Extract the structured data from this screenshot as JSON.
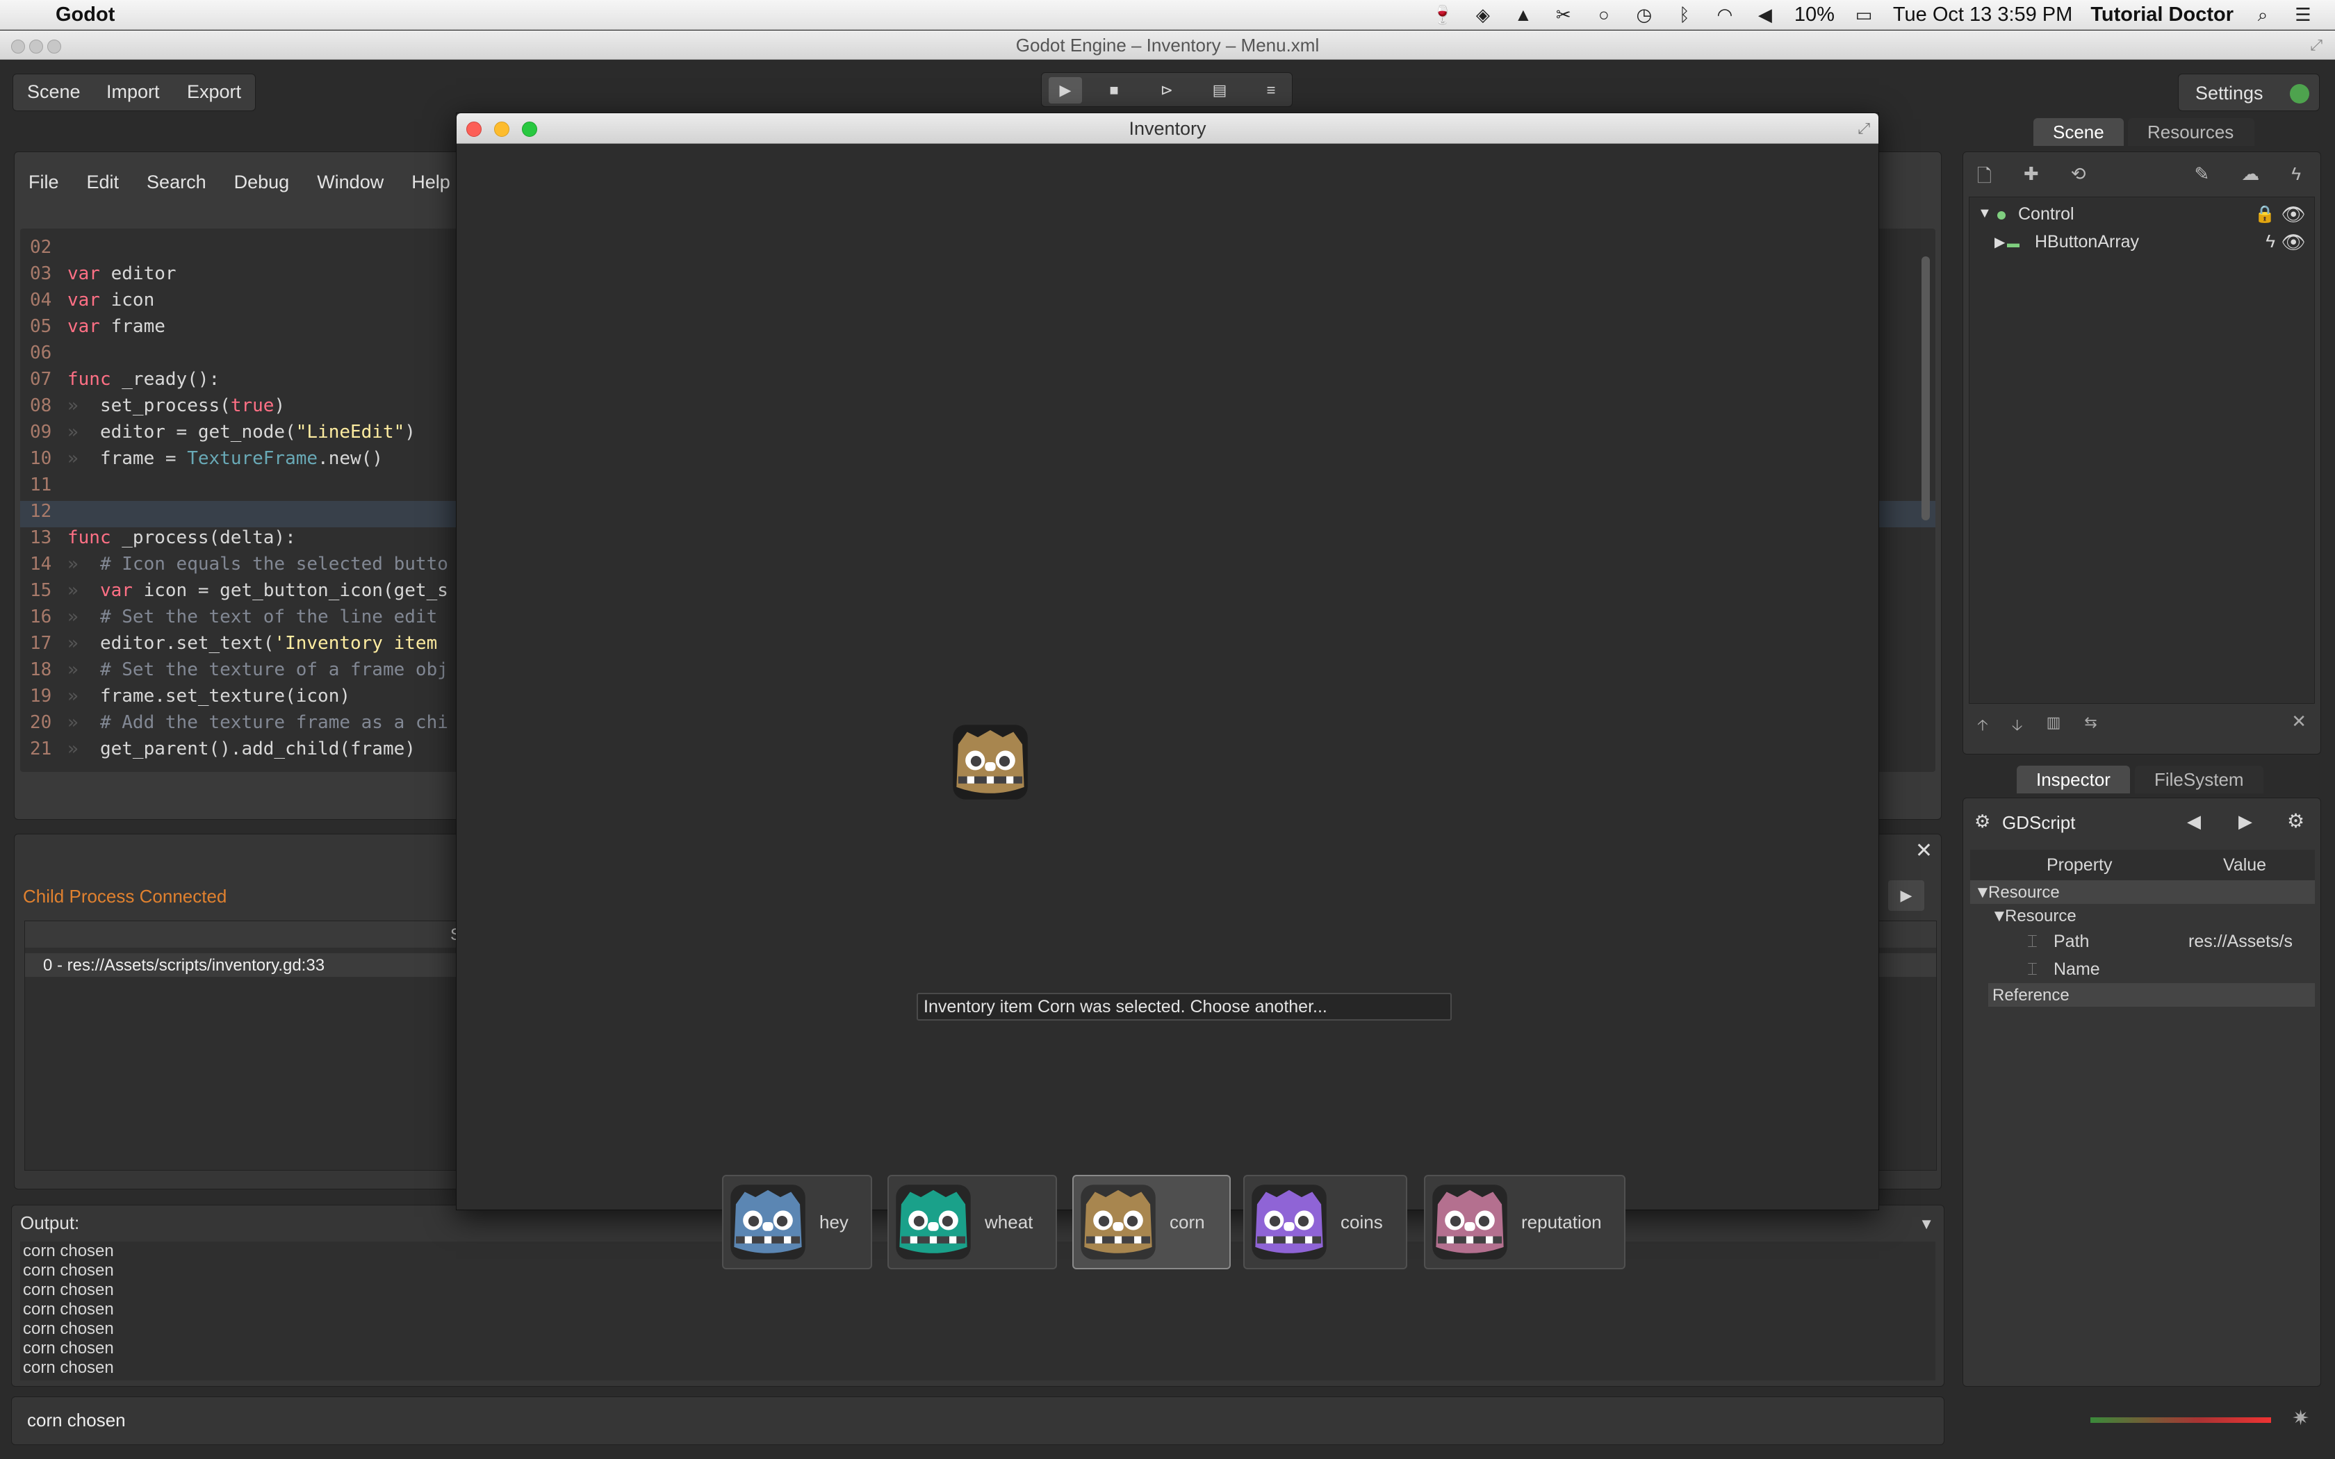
{
  "menubar": {
    "app_name": "Godot",
    "battery": "10%",
    "clock": "Tue Oct 13  3:59 PM",
    "user": "Tutorial Doctor"
  },
  "window": {
    "title": "Godot Engine – Inventory – Menu.xml"
  },
  "toolbar": {
    "menu": [
      "Scene",
      "Import",
      "Export"
    ],
    "settings_label": "Settings"
  },
  "script_menu": [
    "File",
    "Edit",
    "Search",
    "Debug",
    "Window",
    "Help"
  ],
  "code_lines": [
    {
      "n": "02",
      "t": ""
    },
    {
      "n": "03",
      "t": "var editor"
    },
    {
      "n": "04",
      "t": "var icon"
    },
    {
      "n": "05",
      "t": "var frame"
    },
    {
      "n": "06",
      "t": ""
    },
    {
      "n": "07",
      "t": "func _ready():"
    },
    {
      "n": "08",
      "t": "set_process(true)"
    },
    {
      "n": "09",
      "t": "editor = get_node(\"LineEdit\")"
    },
    {
      "n": "10",
      "t": "frame = TextureFrame.new()"
    },
    {
      "n": "11",
      "t": ""
    },
    {
      "n": "12",
      "t": ""
    },
    {
      "n": "13",
      "t": "func _process(delta):"
    },
    {
      "n": "14",
      "t": "# Icon equals the selected butto"
    },
    {
      "n": "15",
      "t": "var icon = get_button_icon(get_s"
    },
    {
      "n": "16",
      "t": "# Set the text of the line edit"
    },
    {
      "n": "17",
      "t": "editor.set_text('Inventory item"
    },
    {
      "n": "18",
      "t": "# Set the texture of a frame obj"
    },
    {
      "n": "19",
      "t": "frame.set_texture(icon)"
    },
    {
      "n": "20",
      "t": "# Add the texture frame as a chi"
    },
    {
      "n": "21",
      "t": "get_parent().add_child(frame)"
    }
  ],
  "debugger": {
    "status": "Child Process Connected",
    "stack_header": "St",
    "stack_item": "0 - res://Assets/scripts/inventory.gd:33"
  },
  "output": {
    "label": "Output:",
    "lines": [
      "corn chosen",
      "corn chosen",
      "corn chosen",
      "corn chosen",
      "corn chosen",
      "corn chosen",
      "corn chosen"
    ],
    "status_line": "corn chosen"
  },
  "scene_dock": {
    "tabs": [
      "Scene",
      "Resources"
    ],
    "tree": [
      "Control",
      "HButtonArray"
    ]
  },
  "inspector": {
    "tabs": [
      "Inspector",
      "FileSystem"
    ],
    "object": "GDScript",
    "col_property": "Property",
    "col_value": "Value",
    "section": "Resource",
    "subsection": "Resource",
    "path_label": "Path",
    "path_value": "res://Assets/s",
    "name_label": "Name",
    "reference": "Reference"
  },
  "game_window": {
    "title": "Inventory",
    "message": "Inventory item Corn was selected. Choose another...",
    "items": [
      {
        "label": "hey",
        "color": "#5b86b3"
      },
      {
        "label": "wheat",
        "color": "#1aa18a"
      },
      {
        "label": "corn",
        "color": "#a8864f",
        "selected": true
      },
      {
        "label": "coins",
        "color": "#8f64d6"
      },
      {
        "label": "reputation",
        "color": "#b4708f"
      }
    ]
  },
  "colors": {
    "accent_orange": "#e0812f",
    "editor_bg": "#2f2f2f",
    "keyword": "#ff7085"
  }
}
